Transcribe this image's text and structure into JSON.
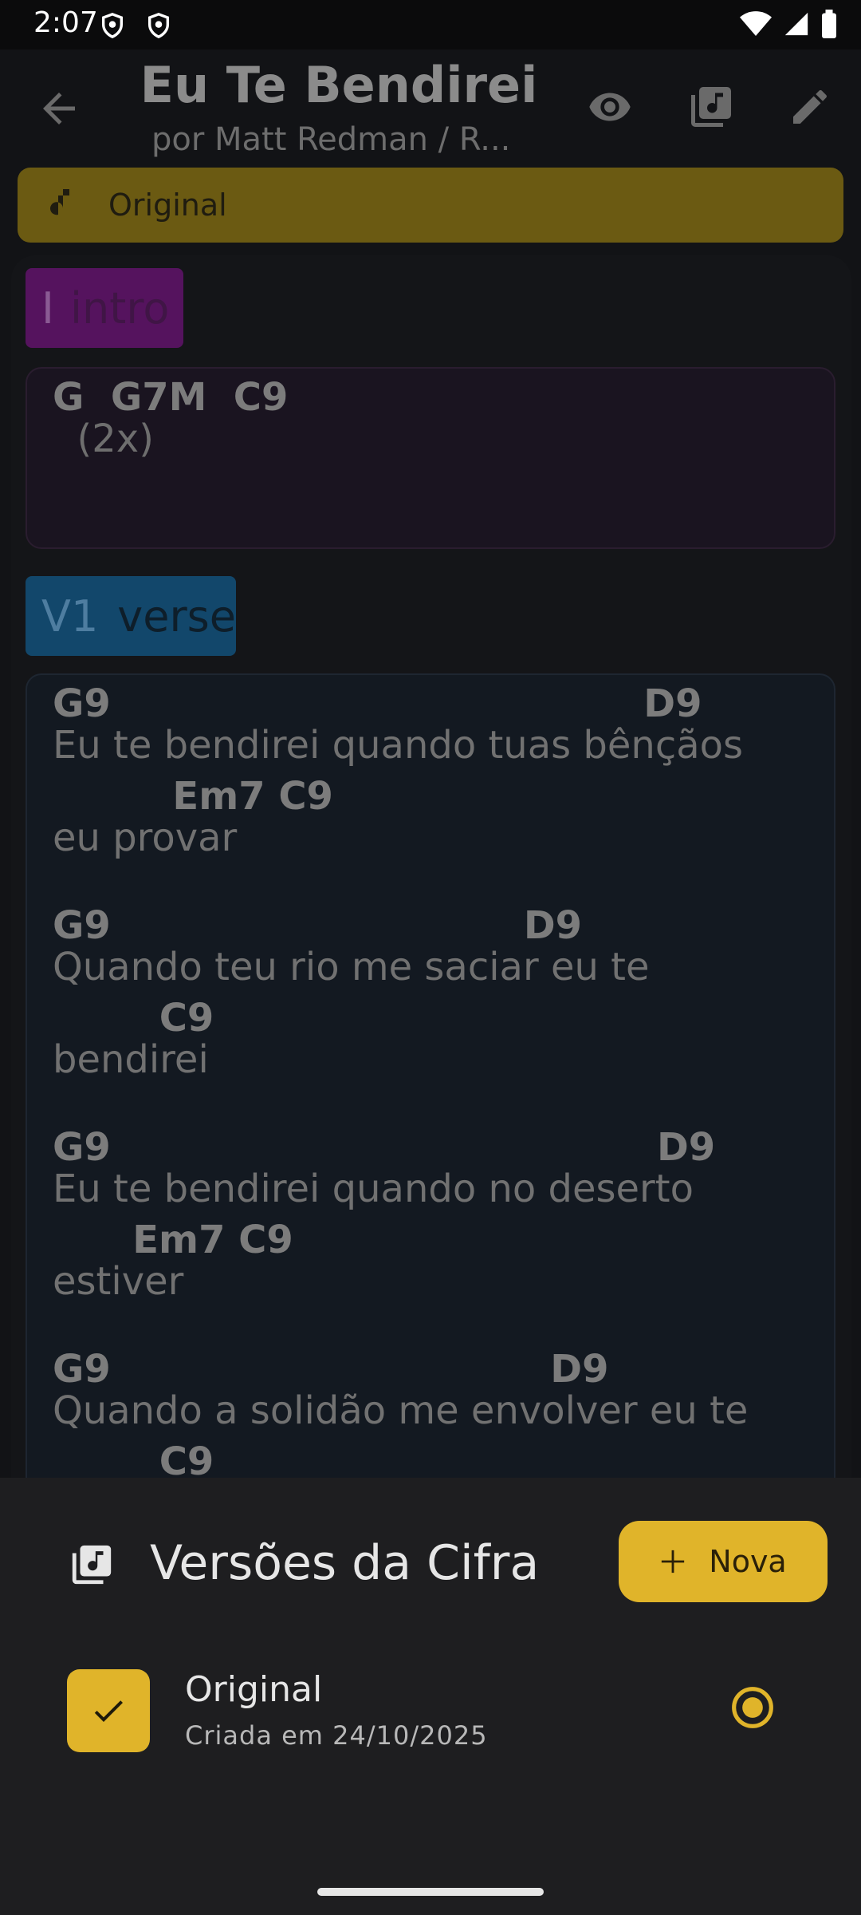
{
  "status_bar": {
    "time": "2:07"
  },
  "header": {
    "title": "Eu Te Bendirei",
    "subtitle": "por Matt Redman / R..."
  },
  "version_chip": {
    "label": "Original"
  },
  "sections": {
    "intro": {
      "code": "I",
      "name": "intro"
    },
    "verse": {
      "code": "V1",
      "name": "verse"
    }
  },
  "intro_block": {
    "chords": "G  G7M  C9",
    "note": "  (2x)"
  },
  "verse_block": {
    "lines": [
      {
        "chords": "G9                                        D9",
        "lyric": "Eu te bendirei quando tuas bênçãos"
      },
      {
        "chords": "         Em7 C9",
        "lyric": "eu provar"
      },
      {
        "chords": "G9                               D9",
        "lyric": "Quando teu rio me saciar eu te"
      },
      {
        "chords": "        C9",
        "lyric": "bendirei"
      },
      {
        "chords": "G9                                         D9",
        "lyric": "Eu te bendirei quando no deserto"
      },
      {
        "chords": "      Em7 C9",
        "lyric": "estiver"
      },
      {
        "chords": "G9                                 D9",
        "lyric": "Quando a solidão me envolver eu te"
      },
      {
        "chords": "        C9",
        "lyric": ""
      }
    ]
  },
  "bottom_sheet": {
    "title": "Versões da Cifra",
    "new_button_label": "Nova",
    "versions": [
      {
        "name": "Original",
        "date": "Criada em 24/10/2025",
        "selected": true
      }
    ]
  },
  "colors": {
    "accent": "#e0b42a",
    "intro_tag": "#55135e",
    "verse_tag": "#12476b",
    "sheet_bg": "#1e1e20"
  },
  "icons": [
    "back-arrow-icon",
    "eye-icon",
    "music-library-icon",
    "edit-icon",
    "music-note-icon",
    "plus-icon",
    "check-icon",
    "radio-selected-icon",
    "shield-icon",
    "wifi-icon",
    "signal-icon",
    "battery-icon"
  ]
}
